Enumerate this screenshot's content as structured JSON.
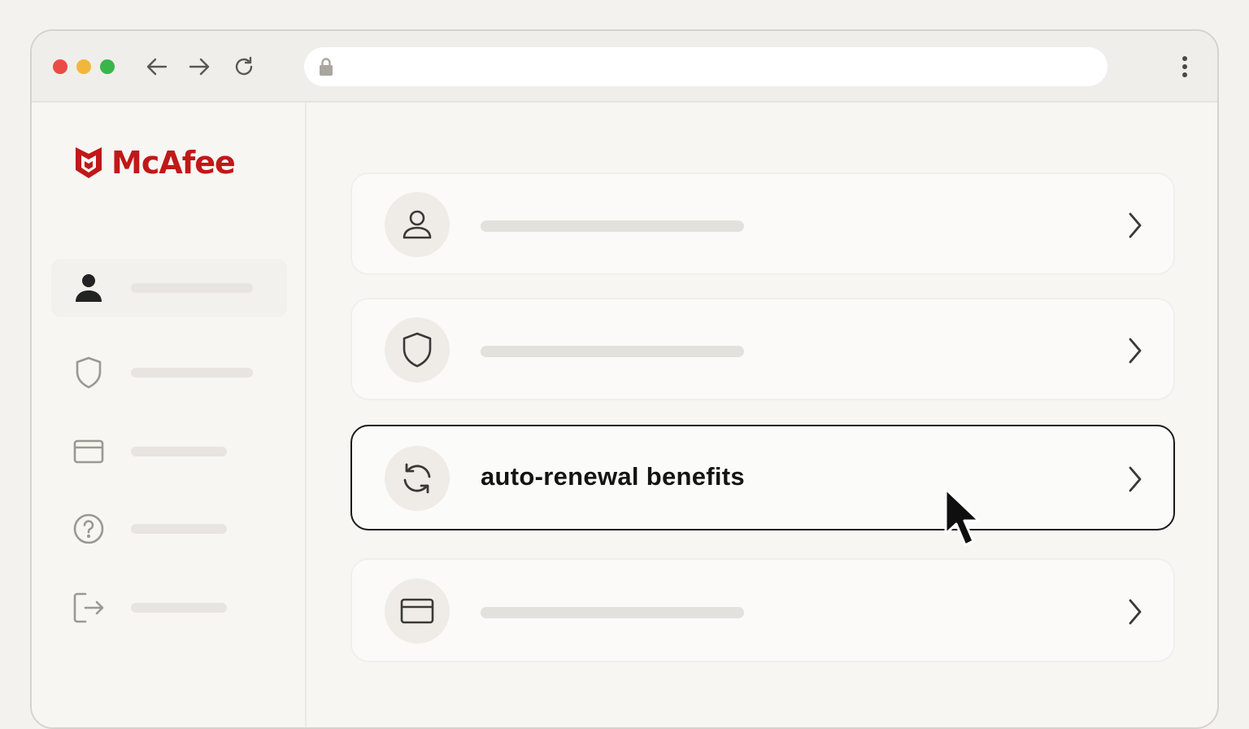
{
  "browser": {
    "address_value": "",
    "icons": [
      "back-arrow-icon",
      "forward-arrow-icon",
      "reload-icon",
      "lock-icon",
      "more-vertical-icon"
    ]
  },
  "brand": {
    "name": "McAfee",
    "color": "#c01818"
  },
  "sidebar": {
    "items": [
      {
        "icon": "user-icon",
        "label": "",
        "active": true
      },
      {
        "icon": "shield-icon",
        "label": "",
        "active": false
      },
      {
        "icon": "credit-card-icon",
        "label": "",
        "active": false
      },
      {
        "icon": "help-circle-icon",
        "label": "",
        "active": false
      },
      {
        "icon": "logout-icon",
        "label": "",
        "active": false
      }
    ]
  },
  "main": {
    "cards": [
      {
        "icon": "user-icon",
        "label": ""
      },
      {
        "icon": "shield-icon",
        "label": ""
      },
      {
        "icon": "refresh-icon",
        "label": "auto-renewal benefits",
        "highlighted": true
      },
      {
        "icon": "credit-card-icon",
        "label": ""
      }
    ]
  },
  "cursor": {
    "icon": "mouse-pointer-icon"
  }
}
